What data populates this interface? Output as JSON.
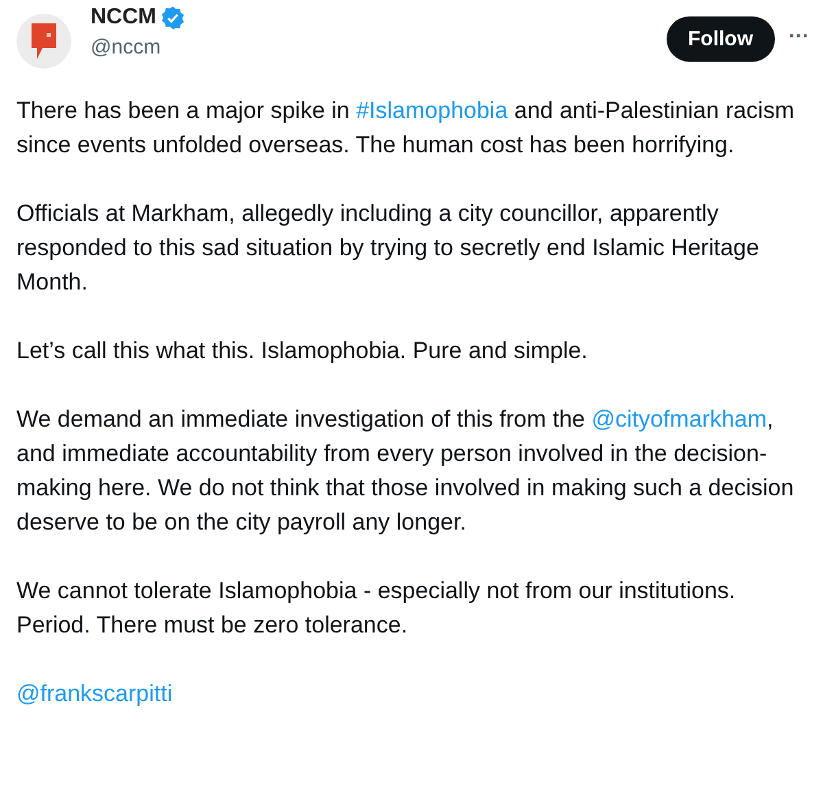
{
  "author": {
    "name": "NCCM",
    "verified": true,
    "handle": "@nccm"
  },
  "follow_button": {
    "label": "Follow"
  },
  "more_button": {
    "label": "···"
  },
  "paragraphs": [
    [
      {
        "kind": "text",
        "text": "There has been a major spike in "
      },
      {
        "kind": "link",
        "text": "#Islamophobia"
      },
      {
        "kind": "text",
        "text": " and anti-Palestinian racism since events unfolded overseas. The human cost has been horrifying."
      }
    ],
    [
      {
        "kind": "text",
        "text": "Officials at Markham, allegedly including a city councillor, apparently responded to this sad situation by trying to secretly end Islamic Heritage Month."
      }
    ],
    [
      {
        "kind": "text",
        "text": "Let’s call this what this. Islamophobia. Pure and simple."
      }
    ],
    [
      {
        "kind": "text",
        "text": "We demand an immediate investigation of this from the "
      },
      {
        "kind": "link",
        "text": "@cityofmarkham"
      },
      {
        "kind": "text",
        "text": ", and immediate accountability from every person involved in the decision-making here. We do not think that those involved in making such a decision deserve to be on the city payroll any longer."
      }
    ],
    [
      {
        "kind": "text",
        "text": "We cannot tolerate Islamophobia - especially not from our institutions. Period. There must be zero tolerance."
      }
    ],
    [
      {
        "kind": "link",
        "text": "@frankscarpitti"
      }
    ]
  ]
}
